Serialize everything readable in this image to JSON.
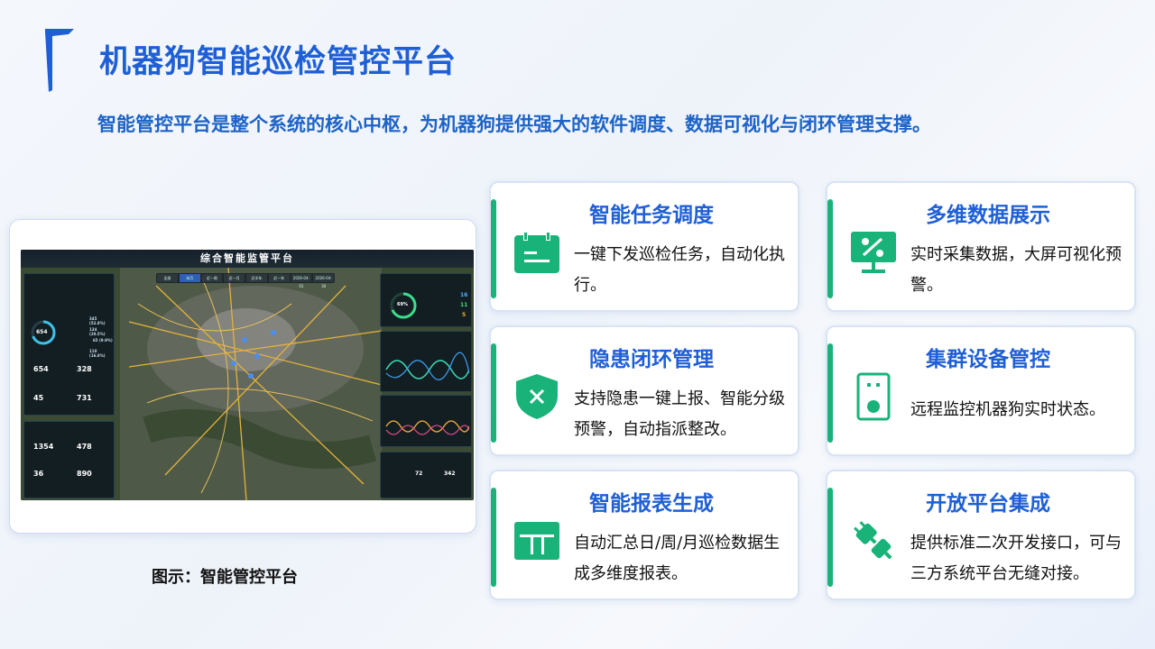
{
  "title": "机器狗智能巡检管控平台",
  "subtitle": "智能管控平台是整个系统的核心中枢，为机器狗提供强大的软件调度、数据可视化与闭环管理支撑。",
  "caption": "图示：智能管控平台",
  "accent_color": "#1f5fd6",
  "green_color": "#19b37a",
  "dashboard": {
    "title": "综合智能监管平台",
    "tabs": [
      "全部",
      "本月",
      "近一周",
      "近一月",
      "近半年",
      "近一年",
      "2026-04-01",
      "2026-04-30"
    ],
    "left_stats": [
      "654",
      "328",
      "45",
      "731",
      "1354",
      "478",
      "36",
      "890"
    ],
    "gauge_value": "654",
    "gauge_pct": "69%",
    "right_stats": [
      "16",
      "11",
      "5"
    ],
    "legend": [
      "345 (52.8%)",
      "134 (20.5%)",
      "65 (9.9%)",
      "110 (16.8%)"
    ],
    "bottom_stats": [
      "72",
      "342"
    ]
  },
  "cards": [
    {
      "title": "智能任务调度",
      "desc": "一键下发巡检任务，自动化执行。",
      "icon": "calendar-icon"
    },
    {
      "title": "多维数据展示",
      "desc": "实时采集数据，大屏可视化预警。",
      "icon": "monitor-icon"
    },
    {
      "title": "隐患闭环管理",
      "desc": "支持隐患一键上报、智能分级预警，自动指派整改。",
      "icon": "shield-icon"
    },
    {
      "title": "集群设备管控",
      "desc": "远程监控机器狗实时状态。",
      "icon": "device-icon"
    },
    {
      "title": "智能报表生成",
      "desc": "自动汇总日/周/月巡检数据生成多维度报表。",
      "icon": "table-icon"
    },
    {
      "title": "开放平台集成",
      "desc": "提供标准二次开发接口，可与三方系统平台无缝对接。",
      "icon": "plug-icon"
    }
  ]
}
